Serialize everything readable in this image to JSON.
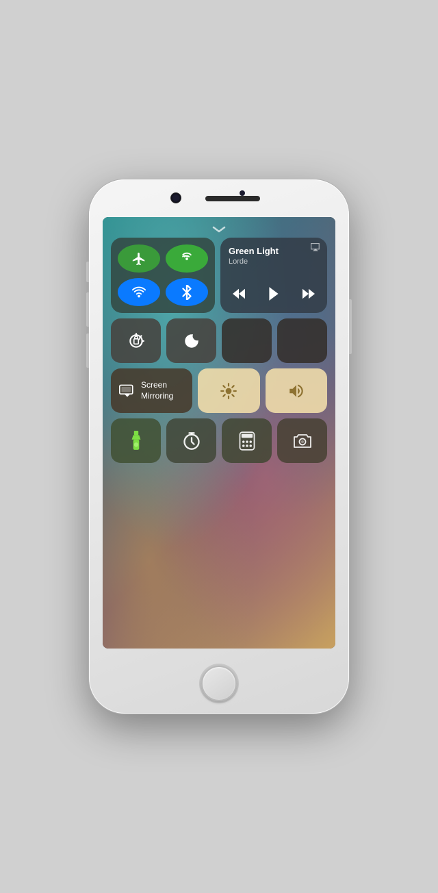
{
  "phone": {
    "screen": {
      "chevron": "⌄",
      "network": {
        "airplane_icon": "✈",
        "cellular_icon": "((·))",
        "wifi_icon": "wifi",
        "bluetooth_icon": "bluetooth"
      },
      "music": {
        "title": "Green Light",
        "artist": "Lorde",
        "rewind": "«",
        "play": "▶",
        "forward": "»"
      },
      "row2": {
        "lock_rotation": "🔒",
        "do_not_disturb": "🌙"
      },
      "screen_mirroring": {
        "label": "Screen\nMirroring"
      },
      "apps": {
        "flashlight": "flashlight",
        "timer": "timer",
        "calculator": "calculator",
        "camera": "camera"
      }
    }
  }
}
